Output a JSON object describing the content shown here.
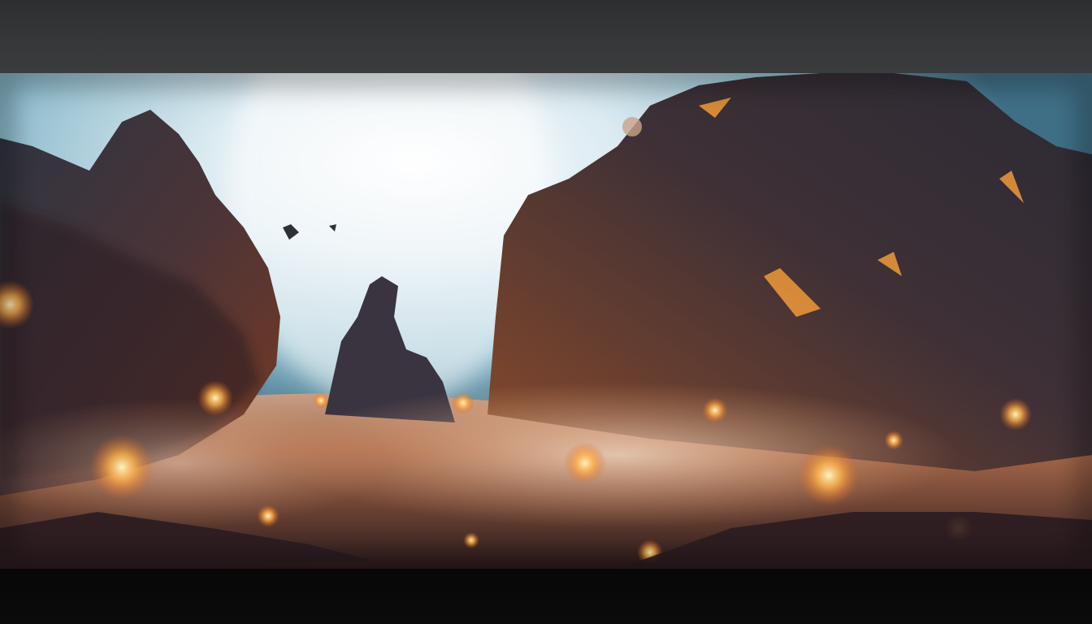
{
  "image": {
    "subject": "fantasy-landscape-canyon",
    "icon": "landscape-image-icon",
    "colors": {
      "sky_glow": "#eef6fa",
      "sky_blue": "#6fa7bd",
      "rock_dark": "#2a2430",
      "rock_mid": "#4a3a3e",
      "ember_orange": "#f08a2a",
      "ember_yellow": "#ffd36a",
      "frame_top": "#36383a",
      "frame_bottom": "#0a0a0b"
    }
  }
}
